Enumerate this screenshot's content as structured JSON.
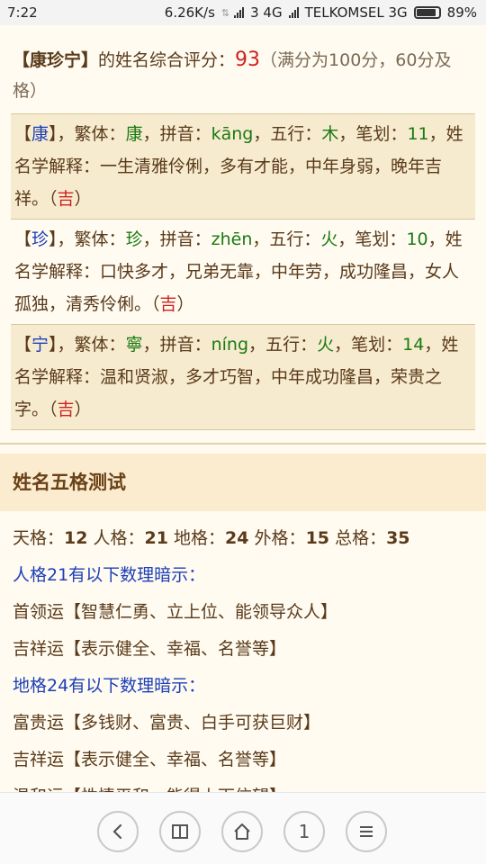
{
  "status": {
    "time": "7:22",
    "speed": "6.26K/s",
    "network": "3 4G",
    "carrier": "TELKOMSEL 3G",
    "battery": "89%",
    "battery_level": 0.89
  },
  "score": {
    "name_bracketed": "【康珍宁】",
    "label": "的姓名综合评分：",
    "value": "93",
    "note": "（满分为100分，60分及格）"
  },
  "characters": [
    {
      "char": "康",
      "traditional": "康",
      "pinyin": "kāng",
      "element": "木",
      "strokes": "11",
      "explanation": "一生清雅伶俐，多有才能，中年身弱，晚年吉祥。",
      "luck": "吉"
    },
    {
      "char": "珍",
      "traditional": "珍",
      "pinyin": "zhēn",
      "element": "火",
      "strokes": "10",
      "explanation": "口快多才，兄弟无靠，中年劳，成功隆昌，女人孤独，清秀伶俐。",
      "luck": "吉"
    },
    {
      "char": "宁",
      "traditional": "寧",
      "pinyin": "níng",
      "element": "火",
      "strokes": "14",
      "explanation": "温和贤淑，多才巧智，中年成功隆昌，荣贵之字。",
      "luck": "吉"
    }
  ],
  "labels": {
    "traditional": "繁体：",
    "pinyin": "拼音：",
    "element": "五行：",
    "strokes": "笔划：",
    "explanation": "姓名学解释："
  },
  "wuge": {
    "title": "姓名五格测试",
    "tian_label": "天格：",
    "tian": "12",
    "ren_label": "人格：",
    "ren": "21",
    "di_label": "地格：",
    "di": "24",
    "wai_label": "外格：",
    "wai": "15",
    "zong_label": "总格：",
    "zong": "35",
    "hint1": "人格21有以下数理暗示：",
    "items1": [
      "首领运【智慧仁勇、立上位、能领导众人】",
      "吉祥运【表示健全、幸福、名誉等】"
    ],
    "hint2": "地格24有以下数理暗示：",
    "items2": [
      "富贵运【多钱财、富贵、白手可获巨财】",
      "吉祥运【表示健全、幸福、名誉等】",
      "温和运【性情平和、能得上下信望】"
    ]
  },
  "nav": {
    "tab_count": "1"
  }
}
